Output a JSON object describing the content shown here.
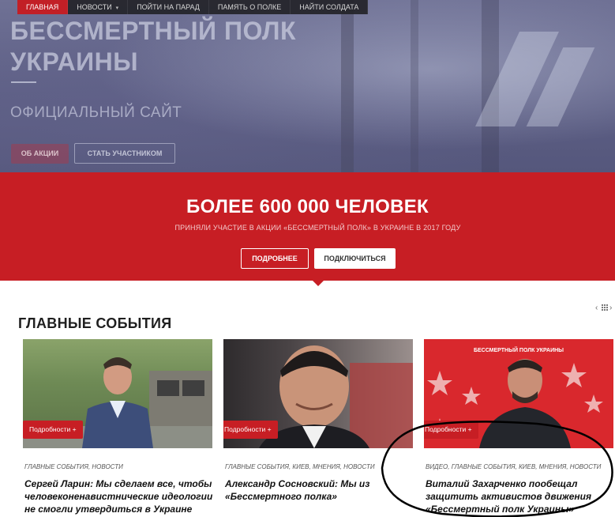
{
  "nav": {
    "items": [
      {
        "label": "ГЛАВНАЯ",
        "active": true
      },
      {
        "label": "НОВОСТИ",
        "has_dropdown": true
      },
      {
        "label": "ПОЙТИ НА ПАРАД"
      },
      {
        "label": "ПАМЯТЬ О ПОЛКЕ"
      },
      {
        "label": "НАЙТИ СОЛДАТА"
      }
    ]
  },
  "hero": {
    "title_line1": "БЕССМЕРТНЫЙ ПОЛК",
    "title_line2": "УКРАИНЫ",
    "subtitle": "ОФИЦИАЛЬНЫЙ САЙТ",
    "about_button": "ОБ АКЦИИ",
    "join_button": "СТАТЬ УЧАСТНИКОМ"
  },
  "banner": {
    "title": "БОЛЕЕ 600 000 ЧЕЛОВЕК",
    "subtitle": "ПРИНЯЛИ УЧАСТИЕ В АКЦИИ «БЕССМЕРТНЫЙ ПОЛК» В УКРАИНЕ В 2017 ГОДУ",
    "more_button": "ПОДРОБНЕЕ",
    "connect_button": "ПОДКЛЮЧИТЬСЯ"
  },
  "events": {
    "section_title": "ГЛАВНЫЕ СОБЫТИЯ",
    "cards": [
      {
        "more_label": "Подробности +",
        "categories": "ГЛАВНЫЕ СОБЫТИЯ, НОВОСТИ",
        "headline": "Сергей Ларин: Мы сделаем все, чтобы человеконенавистнические идеологии не смогли утвердиться в Украине"
      },
      {
        "more_label": "Подробности +",
        "categories": "ГЛАВНЫЕ СОБЫТИЯ, КИЕВ, МНЕНИЯ, НОВОСТИ",
        "headline": "Александр Сосновский: Мы из «Бессмертного полка»"
      },
      {
        "more_label": "Подробности +",
        "categories": "ВИДЕО, ГЛАВНЫЕ СОБЫТИЯ, КИЕВ, МНЕНИЯ, НОВОСТИ",
        "headline": "Виталий Захарченко пообещал защитить активистов движения «Бессмертный полк Украины»",
        "backdrop_text": "БЕССМЕРТНЫЙ ПОЛК УКРАИНЫ"
      }
    ]
  },
  "colors": {
    "brand_red": "#c71e24",
    "nav_bg": "#232328",
    "hero_bg": "#5d5f85"
  }
}
